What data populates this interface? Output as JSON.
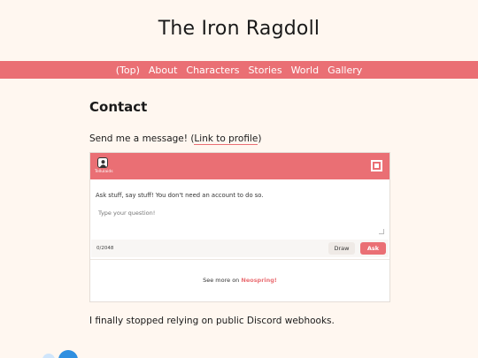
{
  "site": {
    "title": "The Iron Ragdoll"
  },
  "nav": {
    "items": [
      "(Top)",
      "About",
      "Characters",
      "Stories",
      "World",
      "Gallery"
    ]
  },
  "contact": {
    "heading": "Contact",
    "intro_text": "Send me a message! (",
    "profile_link": "Link to profile",
    "intro_close": ")",
    "outro": "I finally stopped relying on public Discord webhooks."
  },
  "widget": {
    "username": "Tellulaids",
    "prompt": "Ask stuff, say stuff! You don't need an account to do so.",
    "placeholder": "Type your question!",
    "char_count": "0/2048",
    "draw_label": "Draw",
    "ask_label": "Ask",
    "see_more_prefix": "See more on ",
    "see_more_link": "Neospring!"
  },
  "colors": {
    "accent": "#ea6f74",
    "background": "#fff7f0",
    "blob_blue": "#2f8fe0"
  },
  "icons": {
    "avatar": "avatar-icon",
    "logo": "neospring-logo-icon"
  }
}
